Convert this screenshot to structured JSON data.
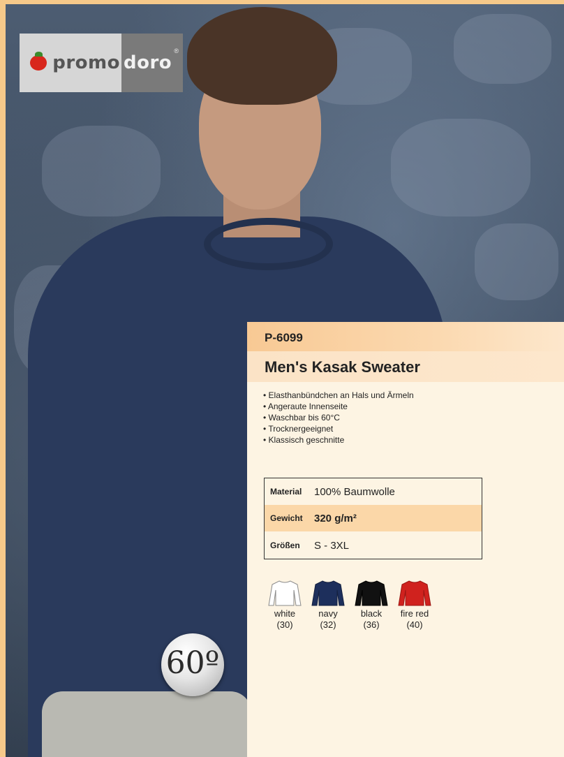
{
  "logo": {
    "part1": "promo",
    "part2": "doro",
    "registered": "®"
  },
  "product": {
    "code": "P-6099",
    "title": "Men's Kasak Sweater",
    "features": [
      "• Elasthanbündchen an Hals und Ärmeln",
      "• Angeraute Innenseite",
      "• Waschbar bis 60°C",
      "• Trocknergeeignet",
      "• Klassisch geschnitte"
    ],
    "specs": [
      {
        "label": "Material",
        "value": "100% Baumwolle"
      },
      {
        "label": "Gewicht",
        "value": "320 g/m²"
      },
      {
        "label": "Größen",
        "value": "S - 3XL"
      }
    ],
    "colors": [
      {
        "name": "white",
        "code": "(30)",
        "hex": "#ffffff"
      },
      {
        "name": "navy",
        "code": "(32)",
        "hex": "#1d2f5c"
      },
      {
        "name": "black",
        "code": "(36)",
        "hex": "#111111"
      },
      {
        "name": "fire red",
        "code": "(40)",
        "hex": "#d0221e"
      }
    ]
  },
  "wash_badge": {
    "text": "60º",
    "icon": "wash-60-icon"
  },
  "colors": {
    "panel_bg": "#fdf4e3",
    "accent": "#f8c994",
    "highlight": "#fbd7a8",
    "sweater": "#2a3a5c"
  }
}
